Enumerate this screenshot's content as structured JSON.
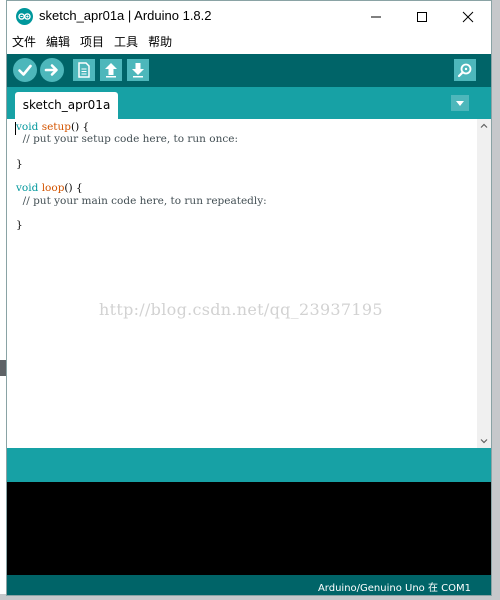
{
  "window": {
    "title": "sketch_apr01a | Arduino 1.8.2"
  },
  "menu": {
    "items": [
      "文件",
      "编辑",
      "项目",
      "工具",
      "帮助"
    ]
  },
  "toolbar": {
    "buttons": [
      {
        "name": "verify-button",
        "icon": "check-icon"
      },
      {
        "name": "upload-button",
        "icon": "arrow-right-icon"
      },
      {
        "name": "new-button",
        "icon": "document-icon"
      },
      {
        "name": "open-button",
        "icon": "arrow-up-icon"
      },
      {
        "name": "save-button",
        "icon": "arrow-down-icon"
      }
    ],
    "serial_monitor_icon": "magnifier-icon"
  },
  "tabs": [
    {
      "label": "sketch_apr01a"
    }
  ],
  "editor": {
    "lines": [
      {
        "type": "void",
        "fn": "setup",
        "rest": "() {"
      },
      {
        "comment": "  // put your setup code here, to run once:"
      },
      {
        "text": ""
      },
      {
        "text": "}"
      },
      {
        "text": ""
      },
      {
        "type": "void",
        "fn": "loop",
        "rest": "() {"
      },
      {
        "comment": "  // put your main code here, to run repeatedly:"
      },
      {
        "text": ""
      },
      {
        "text": "}"
      }
    ],
    "watermark": "http://blog.csdn.net/qq_23937195"
  },
  "footer": {
    "board": "Arduino/Genuino Uno 在 COM1"
  },
  "colors": {
    "toolbar": "#006468",
    "tabstrip": "#17a1a5",
    "button": "#4db7bb",
    "console": "#000000"
  }
}
